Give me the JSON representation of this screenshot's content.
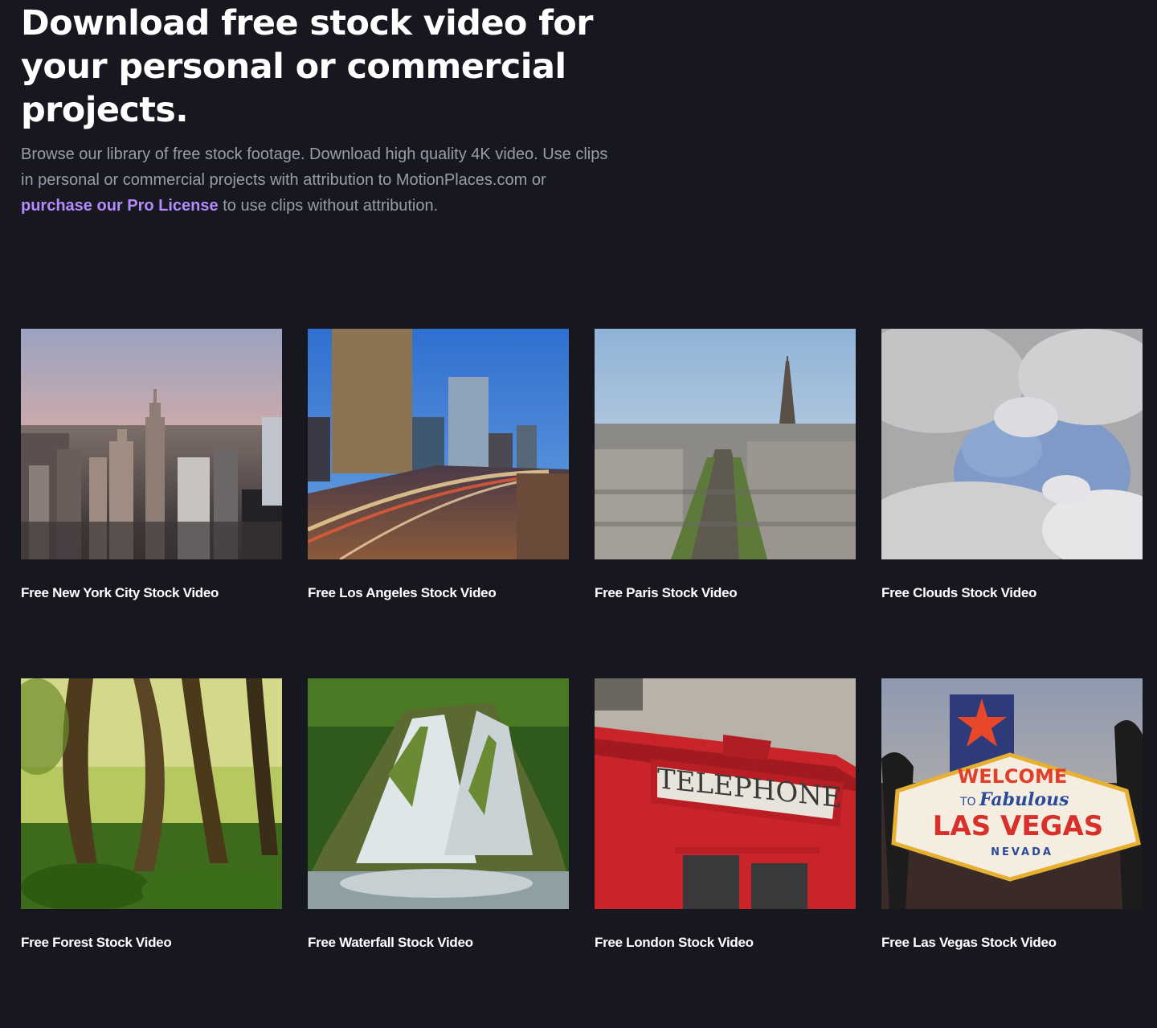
{
  "hero": {
    "title": "Download free stock video for your personal or commercial projects.",
    "description_start": "Browse our library of free stock footage. Download high quality 4K video. Use clips in personal or commercial projects with attribution to MotionPlaces.com or",
    "link_text": "purchase our Pro License",
    "description_end": "to use clips without attribution."
  },
  "cards": [
    {
      "title": "Free New York City Stock Video",
      "thumb": "new-york-skyline-thumbnail"
    },
    {
      "title": "Free Los Angeles Stock Video",
      "thumb": "los-angeles-freeway-thumbnail"
    },
    {
      "title": "Free Paris Stock Video",
      "thumb": "paris-eiffel-tower-thumbnail"
    },
    {
      "title": "Free Clouds Stock Video",
      "thumb": "clouds-sky-thumbnail"
    },
    {
      "title": "Free Forest Stock Video",
      "thumb": "forest-trees-thumbnail"
    },
    {
      "title": "Free Waterfall Stock Video",
      "thumb": "waterfall-thumbnail"
    },
    {
      "title": "Free London Stock Video",
      "thumb": "london-telephone-box-thumbnail"
    },
    {
      "title": "Free Las Vegas Stock Video",
      "thumb": "las-vegas-sign-thumbnail"
    }
  ],
  "thumb_text": {
    "telephone": "TELEPHONE",
    "vegas_welcome": "WELCOME",
    "vegas_to": "TO",
    "vegas_fabulous": "Fabulous",
    "vegas_las_vegas": "LAS VEGAS",
    "vegas_nevada": "NEVADA"
  }
}
